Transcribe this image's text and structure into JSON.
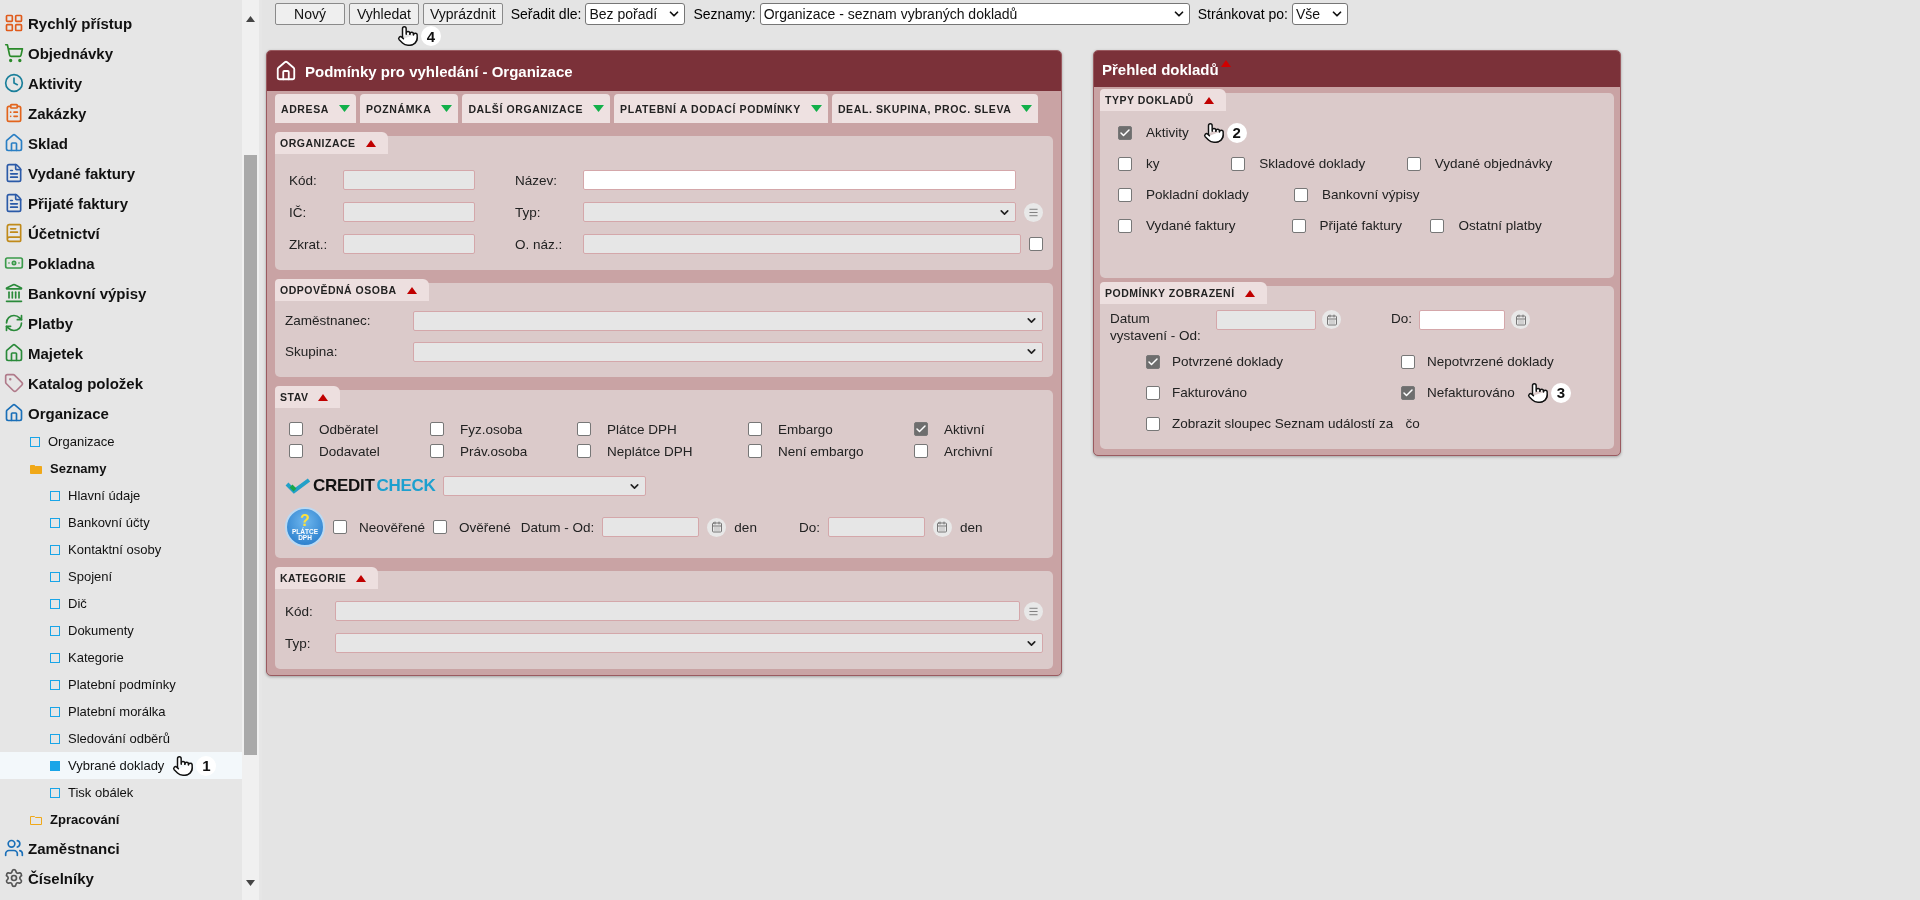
{
  "sidebar": {
    "items": [
      {
        "label": "Rychlý přístup",
        "selected": false
      },
      {
        "label": "Objednávky",
        "selected": false
      },
      {
        "label": "Aktivity",
        "selected": false
      },
      {
        "label": "Zakázky",
        "selected": false
      },
      {
        "label": "Sklad",
        "selected": false
      },
      {
        "label": "Vydané faktury",
        "selected": false
      },
      {
        "label": "Přijaté faktury",
        "selected": false
      },
      {
        "label": "Účetnictví",
        "selected": false
      },
      {
        "label": "Pokladna",
        "selected": false
      },
      {
        "label": "Bankovní výpisy",
        "selected": false
      },
      {
        "label": "Platby",
        "selected": false
      },
      {
        "label": "Majetek",
        "selected": false
      },
      {
        "label": "Katalog položek",
        "selected": false
      },
      {
        "label": "Organizace",
        "selected": false,
        "children": [
          {
            "label": "Organizace",
            "kind": "page",
            "selected": false
          },
          {
            "label": "Seznamy",
            "kind": "folder",
            "expanded": true,
            "selected": false,
            "children": [
              {
                "label": "Hlavní údaje",
                "kind": "page",
                "selected": false
              },
              {
                "label": "Bankovní účty",
                "kind": "page",
                "selected": false
              },
              {
                "label": "Kontaktní osoby",
                "kind": "page",
                "selected": false
              },
              {
                "label": "Spojení",
                "kind": "page",
                "selected": false
              },
              {
                "label": "Dič",
                "kind": "page",
                "selected": false
              },
              {
                "label": "Dokumenty",
                "kind": "page",
                "selected": false
              },
              {
                "label": "Kategorie",
                "kind": "page",
                "selected": false
              },
              {
                "label": "Platební podmínky",
                "kind": "page",
                "selected": false
              },
              {
                "label": "Platební morálka",
                "kind": "page",
                "selected": false
              },
              {
                "label": "Sledování odběrů",
                "kind": "page",
                "selected": false
              },
              {
                "label": "Vybrané doklady",
                "kind": "page",
                "selected": true,
                "callout": "1"
              },
              {
                "label": "Tisk obálek",
                "kind": "page",
                "selected": false
              }
            ]
          },
          {
            "label": "Zpracování",
            "kind": "folder",
            "expanded": false,
            "selected": false
          }
        ]
      },
      {
        "label": "Zaměstnanci",
        "selected": false
      },
      {
        "label": "Číselníky",
        "selected": false
      }
    ]
  },
  "toolbar": {
    "buttons": [
      {
        "label": "Nový"
      },
      {
        "label": "Vyhledat",
        "callout": "4"
      },
      {
        "label": "Vyprázdnit"
      }
    ],
    "selects": [
      {
        "label": "Seřadit dle:",
        "value": "Bez pořadí"
      },
      {
        "label": "Seznamy:",
        "value": "Organizace - seznam vybraných dokladů"
      },
      {
        "label": "Stránkovat po:",
        "value": "Vše"
      }
    ]
  },
  "search_panel": {
    "title": "Podmínky pro vyhledání - Organizace",
    "tabs": [
      {
        "label": "ADRESA"
      },
      {
        "label": "POZNÁMKA"
      },
      {
        "label": "DALŠÍ ORGANIZACE"
      },
      {
        "label": "PLATEBNÍ A DODACÍ PODMÍNKY"
      },
      {
        "label": "DEAL. SKUPINA, PROC. SLEVA"
      }
    ],
    "organizace": {
      "title": "ORGANIZACE",
      "left": [
        {
          "label": "Kód:"
        },
        {
          "label": "IČ:"
        },
        {
          "label": "Zkrat.:"
        }
      ],
      "right": [
        {
          "label": "Název:",
          "kind": "text",
          "focused": true
        },
        {
          "label": "Typ:",
          "kind": "select"
        },
        {
          "label": "O. náz.:",
          "kind": "check",
          "checked": false
        }
      ]
    },
    "odpovedna_osoba": {
      "title": "ODPOVĚDNÁ OSOBA",
      "fields": [
        {
          "label": "Zaměstnanec:"
        },
        {
          "label": "Skupina:"
        }
      ]
    },
    "stav": {
      "title": "STAV",
      "checks": [
        {
          "label": "Odběratel",
          "checked": false
        },
        {
          "label": "Dodavatel",
          "checked": false
        },
        {
          "label": "Fyz.osoba",
          "checked": false
        },
        {
          "label": "Práv.osoba",
          "checked": false
        },
        {
          "label": "Plátce DPH",
          "checked": false
        },
        {
          "label": "Neplátce DPH",
          "checked": false
        },
        {
          "label": "Embargo",
          "checked": false
        },
        {
          "label": "Není embargo",
          "checked": false
        },
        {
          "label": "Aktivní",
          "checked": true
        },
        {
          "label": "Archivní",
          "checked": false
        }
      ],
      "logo": [
        "CREDIT",
        "CHECK"
      ],
      "badge": {
        "mark": "?",
        "text": "PLÁTCE DPH"
      },
      "verify": [
        {
          "label": "Neověřené",
          "checked": false
        },
        {
          "label": "Ověřené",
          "checked": false
        }
      ],
      "dates": [
        {
          "label": "Datum - Od:",
          "unit": "den"
        },
        {
          "label": "Do:",
          "unit": "den"
        }
      ]
    },
    "kategorie": {
      "title": "KATEGORIE",
      "fields": [
        {
          "label": "Kód:",
          "kind": "text"
        },
        {
          "label": "Typ:",
          "kind": "select"
        }
      ]
    }
  },
  "overview_panel": {
    "title": "Přehled dokladů",
    "types": {
      "title": "TYPY DOKLADŮ",
      "rows": [
        [
          {
            "label": "Aktivity",
            "checked": true,
            "callout": "2"
          }
        ],
        [
          {
            "label": "ky",
            "checked": false
          },
          {
            "label": "Skladové doklady",
            "checked": false
          },
          {
            "label": "Vydané objednávky",
            "checked": false
          }
        ],
        [
          {
            "label": "Pokladní doklady",
            "checked": false
          },
          {
            "label": "Bankovní výpisy",
            "checked": false
          }
        ],
        [
          {
            "label": "Vydané faktury",
            "checked": false
          },
          {
            "label": "Přijaté faktury",
            "checked": false
          },
          {
            "label": "Ostatní platby",
            "checked": false
          }
        ]
      ]
    },
    "display": {
      "title": "PODMÍNKY ZOBRAZENÍ",
      "dates": [
        {
          "label": "Datum vystavení - Od:"
        },
        {
          "label": "Do:"
        }
      ],
      "checks": [
        {
          "label": "Potvrzené doklady",
          "checked": true
        },
        {
          "label": "Nepotvrzené doklady",
          "checked": false
        },
        {
          "label": "Fakturováno",
          "checked": false
        },
        {
          "label": "Nefakturováno",
          "checked": true,
          "callout": "3"
        },
        {
          "label": "Zobrazit sloupec Seznam událostí za",
          "tail": "čo",
          "checked": false
        }
      ]
    }
  }
}
